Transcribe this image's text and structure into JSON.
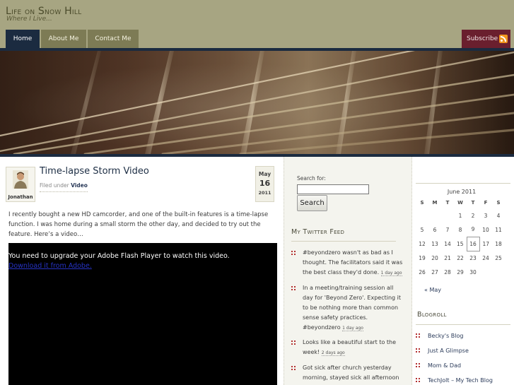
{
  "site": {
    "title_parts": [
      "L",
      "ife on ",
      "S",
      "now ",
      "H",
      "ill"
    ],
    "tagline": "Where I Live..."
  },
  "nav": {
    "items": [
      {
        "label": "Home",
        "active": true
      },
      {
        "label": "About Me",
        "active": false
      },
      {
        "label": "Contact Me",
        "active": false
      }
    ],
    "subscribe_label": "Subscribe"
  },
  "post": {
    "author": "Jonathan",
    "title": "Time-lapse Storm Video",
    "filed_prefix": "Filed under",
    "category": "Video",
    "date": {
      "month": "May",
      "day": "16",
      "year": "2011"
    },
    "body": "I recently bought a new HD camcorder, and one of the built-in features is a time-lapse function. I was home during a small storm the other day, and decided to try out the feature. Here’s a video…",
    "video_message": "You need to upgrade your Adobe Flash Player to watch this video.",
    "video_link": "Download it from Adobe."
  },
  "search": {
    "label": "Search for:",
    "value": "",
    "button": "Search"
  },
  "twitter": {
    "title": "My Twitter Feed",
    "tweets": [
      {
        "text": "#beyondzero wasn't as bad as I thought. The facilitators said it was the best class they'd done.",
        "ago": "1 day ago"
      },
      {
        "text": "In a meeting/training session all day for 'Beyond Zero'. Expecting it to be nothing more than common sense safety practices. #beyondzero",
        "ago": "1 day ago"
      },
      {
        "text": "Looks like a beautiful start to the week!",
        "ago": "2 days ago"
      },
      {
        "text": "Got sick after church yesterday morning, stayed sick all afternoon",
        "ago": ""
      }
    ]
  },
  "calendar": {
    "caption": "June 2011",
    "weekdays": [
      "S",
      "M",
      "T",
      "W",
      "T",
      "F",
      "S"
    ],
    "weeks": [
      [
        "",
        "",
        "",
        "1",
        "2",
        "3",
        "4"
      ],
      [
        "5",
        "6",
        "7",
        "8",
        "9",
        "10",
        "11"
      ],
      [
        "12",
        "13",
        "14",
        "15",
        "16",
        "17",
        "18"
      ],
      [
        "19",
        "20",
        "21",
        "22",
        "23",
        "24",
        "25"
      ],
      [
        "26",
        "27",
        "28",
        "29",
        "30",
        "",
        ""
      ]
    ],
    "today": "16",
    "prev_link": "« May"
  },
  "blogroll": {
    "title": "Blogroll",
    "items": [
      "Becky's Blog",
      "Just A Glimpse",
      "Mom & Dad",
      "TechJolt – My Tech Blog"
    ]
  },
  "colors": {
    "header_bg": "#a7a582",
    "nav_active": "#1b2b40",
    "nav_item": "#7d7b55",
    "subscribe_bg": "#6a1f2e",
    "rss": "#f0951e",
    "bullet": "#b43030"
  }
}
